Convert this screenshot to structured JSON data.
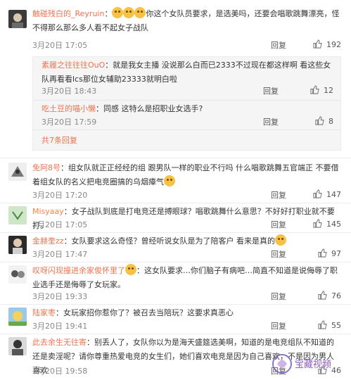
{
  "reply_label": "回复",
  "comments": [
    {
      "user": "触碰残白的_Reyruin",
      "text_a": "：",
      "text_b": "你这个女队员要求，是选美吗，还要会唱歌跳舞漂亮，怪不得那么那么多人看不起女子战队",
      "time": "3月20日 17:05",
      "likes": "192",
      "replies": [
        {
          "user": "素履之往往往OuO",
          "text": "：就是我女主播 没说那么白而已2333不过现在都这样啊 看这些女队再看看lcs那位女辅助23333就明白啦",
          "time": "3月20日 18:43",
          "likes": "12"
        },
        {
          "user": "吃土豆的喵小懒",
          "text": "：同感 这特么是招职业女选手?",
          "time": "3月20日 17:59",
          "likes": "8"
        }
      ],
      "more": "共7条回复"
    },
    {
      "user": "免阿8号",
      "text": "：组女队就正正经经的组 跟男队一样的职业不行吗 什么唱歌跳舞五官端正 不要借着组女队的名义把电竞圈搞的乌烟瘴气",
      "time": "3月20日 17:20",
      "likes": "147"
    },
    {
      "user": "Misyaay",
      "text": "：女子战队到底是打电竞还是搏眼球？唱歌跳舞什么意思？不好好打职业就不要打。",
      "time": "3月20日 17:05",
      "likes": "145"
    },
    {
      "user": "金赫奎zz",
      "text": "：女队要求这么奇怪？曾经听说女队是为了陪客户 看来是真的",
      "time": "3月20日 17:47",
      "likes": "97"
    },
    {
      "user": "叹呀闪现撞进余家俊怀里了",
      "text": "：这女队要求…你们脑子有病吧…简直不知道是说侮辱了职业选手还是侮辱了女玩家。",
      "time": "3月20日 19:33",
      "likes": "76"
    },
    {
      "user": "陆家枣",
      "text": "：女玩家招你惹你了？被召去当陪玩？这要求真恶心",
      "time": "3月20日 19:41",
      "likes": "55"
    },
    {
      "user": "此去余生无往寄",
      "text": "：别丢人了，女队你以为是海天盛筵选美啊，知道的是电竞组队不知道的还是卖淫呢？请你尊重热爱电竞的女生们，她们喜欢电竞是因为自己喜欢，不是因为男人喜欢",
      "time": "3月20日 19:58",
      "likes": "46"
    }
  ],
  "watermark": "宝藏视频"
}
